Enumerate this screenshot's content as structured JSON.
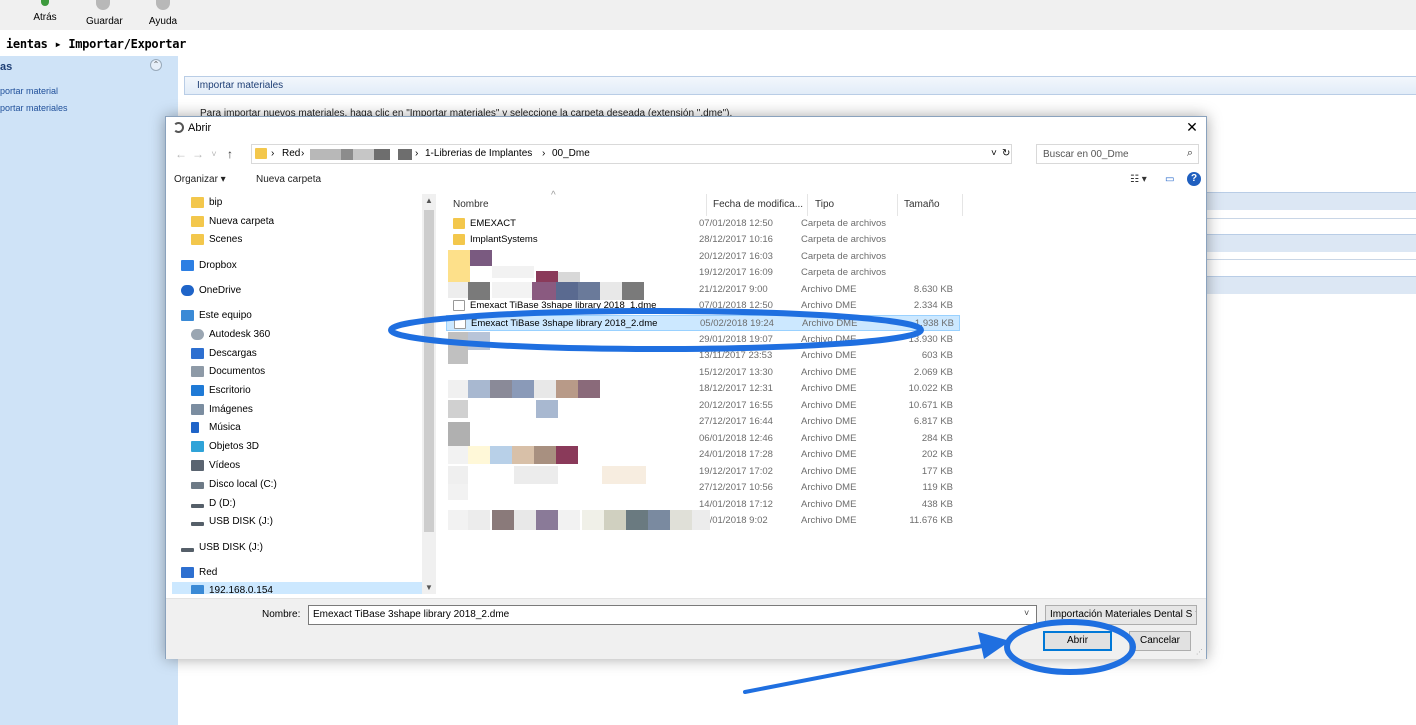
{
  "app": {
    "toolbar": {
      "back": "Atrás",
      "save": "Guardar",
      "help": "Ayuda"
    },
    "breadcrumb": "ientas ▸ Importar/Exportar",
    "sidebar": {
      "section": "as",
      "collapse_glyph": "⌃",
      "items": [
        "portar material",
        "portar materiales"
      ]
    },
    "main_header": "Importar materiales",
    "main_description": "Para importar nuevos materiales, haga clic en \"Importar materiales\" y seleccione la carpeta deseada (extensión \".dme\")."
  },
  "dialog": {
    "title": "Abrir",
    "close_glyph": "✕",
    "nav_glyphs": {
      "back": "←",
      "forward": "→",
      "recent": "˅",
      "up": "↑"
    },
    "address": {
      "sep": "›",
      "red": "Red",
      "library": "1-Librerias de Implantes",
      "current": "00_Dme",
      "dropdown_glyph": "˅",
      "refresh_glyph": "↻"
    },
    "search": {
      "placeholder": "Buscar en 00_Dme",
      "icon_glyph": "⌕"
    },
    "commands": {
      "organize": "Organizar ▾",
      "new_folder": "Nueva carpeta",
      "view_glyph": "☷ ▾",
      "pane_glyph": "▭",
      "help_glyph": "?"
    },
    "nav_items": [
      {
        "label": "bip",
        "icon": "folder-icon",
        "color": "#f3c74c"
      },
      {
        "label": "Nueva carpeta",
        "icon": "folder-icon",
        "color": "#f3c74c"
      },
      {
        "label": "Scenes",
        "icon": "folder-icon",
        "color": "#f3c74c"
      },
      {
        "label": "Dropbox",
        "icon": "dropbox-icon",
        "color": "#2d7fe3"
      },
      {
        "label": "OneDrive",
        "icon": "onedrive-icon",
        "color": "#1f64c8"
      },
      {
        "label": "Este equipo",
        "icon": "computer-icon",
        "color": "#3a8ad6"
      },
      {
        "label": "Autodesk 360",
        "icon": "cloud-icon",
        "color": "#9aa6b2"
      },
      {
        "label": "Descargas",
        "icon": "download-icon",
        "color": "#2d6fd0"
      },
      {
        "label": "Documentos",
        "icon": "document-icon",
        "color": "#8e9aa7"
      },
      {
        "label": "Escritorio",
        "icon": "desktop-icon",
        "color": "#1f7ad6"
      },
      {
        "label": "Imágenes",
        "icon": "images-icon",
        "color": "#7b8da0"
      },
      {
        "label": "Música",
        "icon": "music-icon",
        "color": "#1f64c8"
      },
      {
        "label": "Objetos 3D",
        "icon": "cube-icon",
        "color": "#2fa3d8"
      },
      {
        "label": "Vídeos",
        "icon": "video-icon",
        "color": "#5a6470"
      },
      {
        "label": "Disco local (C:)",
        "icon": "drive-icon",
        "color": "#6d7a86"
      },
      {
        "label": "D (D:)",
        "icon": "drive-icon",
        "color": "#555f69"
      },
      {
        "label": "USB DISK (J:)",
        "icon": "usb-drive-icon",
        "color": "#555f69"
      },
      {
        "label": "USB DISK (J:)",
        "icon": "usb-drive-icon",
        "color": "#555f69"
      },
      {
        "label": "Red",
        "icon": "network-icon",
        "color": "#2d6fd0"
      },
      {
        "label": "192.168.0.154",
        "icon": "network-pc-icon",
        "color": "#3a8ad6"
      }
    ],
    "columns": {
      "name": "Nombre",
      "date": "Fecha de modifica...",
      "type": "Tipo",
      "size": "Tamaño",
      "sort_glyph": "^"
    },
    "files": [
      {
        "name": "EMEXACT",
        "date": "07/01/2018 12:50",
        "type": "Carpeta de archivos",
        "size": "",
        "folder": true
      },
      {
        "name": "ImplantSystems",
        "date": "28/12/2017 10:16",
        "type": "Carpeta de archivos",
        "size": "",
        "folder": true
      },
      {
        "name": "",
        "date": "20/12/2017 16:03",
        "type": "Carpeta de archivos",
        "size": "",
        "folder": true
      },
      {
        "name": "",
        "date": "19/12/2017 16:09",
        "type": "Carpeta de archivos",
        "size": "",
        "folder": true
      },
      {
        "name": "",
        "date": "21/12/2017 9:00",
        "type": "Archivo DME",
        "size": "8.630 KB",
        "folder": false
      },
      {
        "name": "Emexact TiBase 3shape library 2018_1.dme",
        "date": "07/01/2018 12:50",
        "type": "Archivo DME",
        "size": "2.334 KB",
        "folder": false
      },
      {
        "name": "Emexact TiBase 3shape library 2018_2.dme",
        "date": "05/02/2018 19:24",
        "type": "Archivo DME",
        "size": "1.938 KB",
        "folder": false,
        "selected": true
      },
      {
        "name": "",
        "date": "29/01/2018 19:07",
        "type": "Archivo DME",
        "size": "13.930 KB",
        "folder": false
      },
      {
        "name": "",
        "date": "13/11/2017 23:53",
        "type": "Archivo DME",
        "size": "603 KB",
        "folder": false
      },
      {
        "name": "",
        "date": "15/12/2017 13:30",
        "type": "Archivo DME",
        "size": "2.069 KB",
        "folder": false
      },
      {
        "name": "",
        "date": "18/12/2017 12:31",
        "type": "Archivo DME",
        "size": "10.022 KB",
        "folder": false
      },
      {
        "name": "",
        "date": "20/12/2017 16:55",
        "type": "Archivo DME",
        "size": "10.671 KB",
        "folder": false
      },
      {
        "name": "",
        "date": "27/12/2017 16:44",
        "type": "Archivo DME",
        "size": "6.817 KB",
        "folder": false
      },
      {
        "name": "",
        "date": "06/01/2018 12:46",
        "type": "Archivo DME",
        "size": "284 KB",
        "folder": false
      },
      {
        "name": "",
        "date": "24/01/2018 17:28",
        "type": "Archivo DME",
        "size": "202 KB",
        "folder": false
      },
      {
        "name": "",
        "date": "19/12/2017 17:02",
        "type": "Archivo DME",
        "size": "177 KB",
        "folder": false
      },
      {
        "name": "",
        "date": "27/12/2017 10:56",
        "type": "Archivo DME",
        "size": "119 KB",
        "folder": false
      },
      {
        "name": "",
        "date": "14/01/2018 17:12",
        "type": "Archivo DME",
        "size": "438 KB",
        "folder": false
      },
      {
        "name": "",
        "date": "05/01/2018 9:02",
        "type": "Archivo DME",
        "size": "11.676 KB",
        "folder": false
      }
    ],
    "filename_label": "Nombre:",
    "filename_value": "Emexact TiBase 3shape library 2018_2.dme",
    "filename_dropdown_glyph": "˅",
    "filter": "Importación Materiales Dental S ˅",
    "open_button": "Abrir",
    "cancel_button": "Cancelar",
    "grip_glyph": "⋰"
  },
  "colors": {
    "annotation_blue": "#1f6fe0",
    "selection": "#cce8ff",
    "primary_border": "#0078d7"
  }
}
